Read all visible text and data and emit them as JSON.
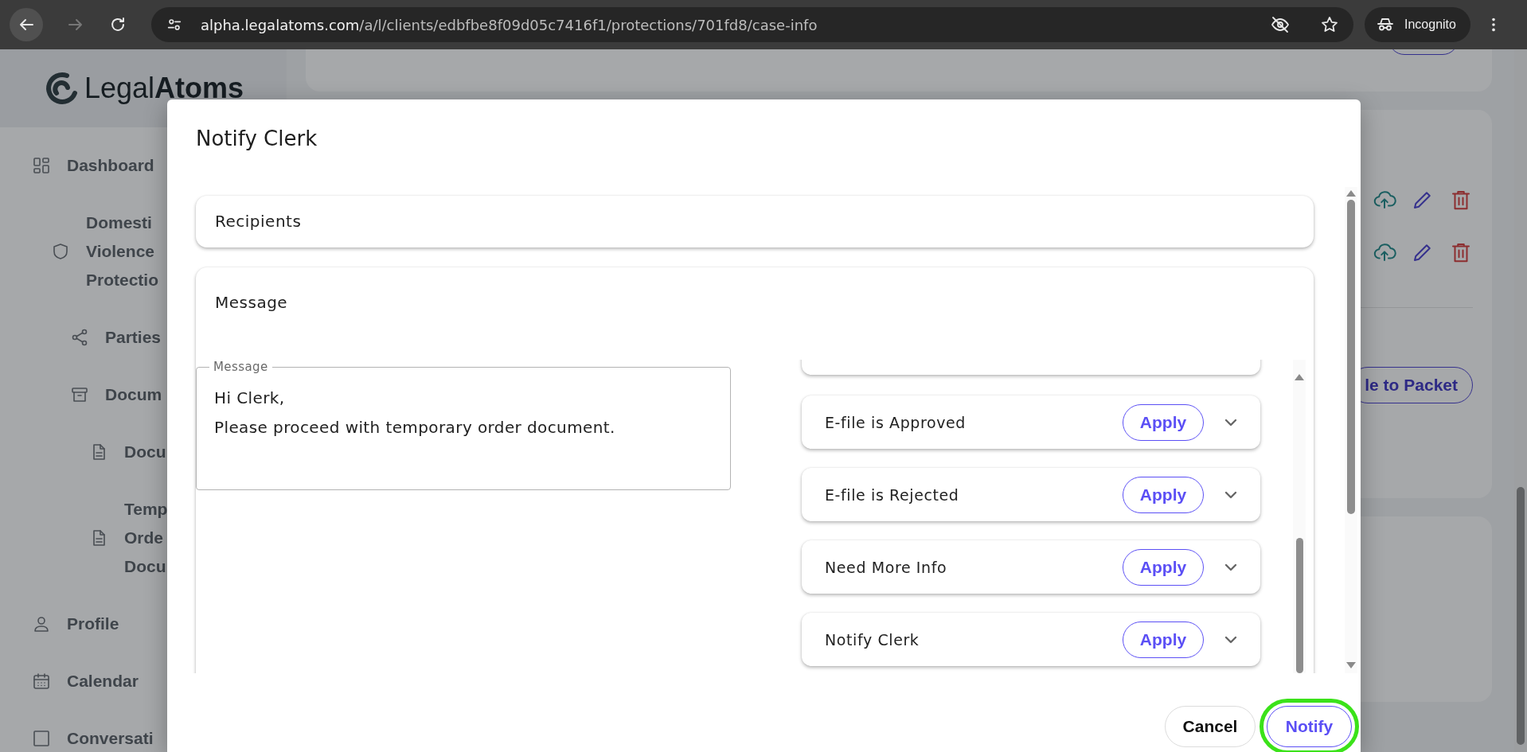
{
  "browser": {
    "url_host": "alpha.legalatoms.com",
    "url_path": "/a/l/clients/edbfbe8f09d05c7416f1/protections/701fd8/case-info",
    "profile": "Incognito"
  },
  "sidebar": {
    "logo": "Legal**Atoms**",
    "items": [
      {
        "label": "Dashboard",
        "children": [
          {
            "label": "Domesti\nViolence\nProtectio",
            "children": [
              {
                "label": "Parties"
              },
              {
                "label": "Docum",
                "children": [
                  {
                    "label": "Docu"
                  },
                  {
                    "label": "Temp\nOrde\nDocu"
                  }
                ]
              }
            ]
          }
        ]
      },
      {
        "label": "Profile"
      },
      {
        "label": "Calendar"
      },
      {
        "label": "Conversati"
      }
    ]
  },
  "background": {
    "packet_button": "le to Packet"
  },
  "dialog": {
    "title": "Notify Clerk",
    "sections": [
      {
        "title": "Recipients",
        "expanded": false
      },
      {
        "title": "Message",
        "expanded": true,
        "field": {
          "label": "Message",
          "value": "Hi Clerk,\nPlease proceed with temporary order document."
        },
        "templates": [
          {
            "name": "E-file is Approved",
            "action": "Apply",
            "expanded": false
          },
          {
            "name": "E-file is Rejected",
            "action": "Apply",
            "expanded": false
          },
          {
            "name": "Need More Info",
            "action": "Apply",
            "expanded": false
          },
          {
            "name": "Notify Clerk",
            "action": "Apply",
            "expanded": false
          }
        ]
      }
    ],
    "buttons": [
      {
        "label": "Cancel",
        "kind": "secondary",
        "highlighted": false
      },
      {
        "label": "Notify",
        "kind": "primary",
        "highlighted": true
      }
    ]
  }
}
